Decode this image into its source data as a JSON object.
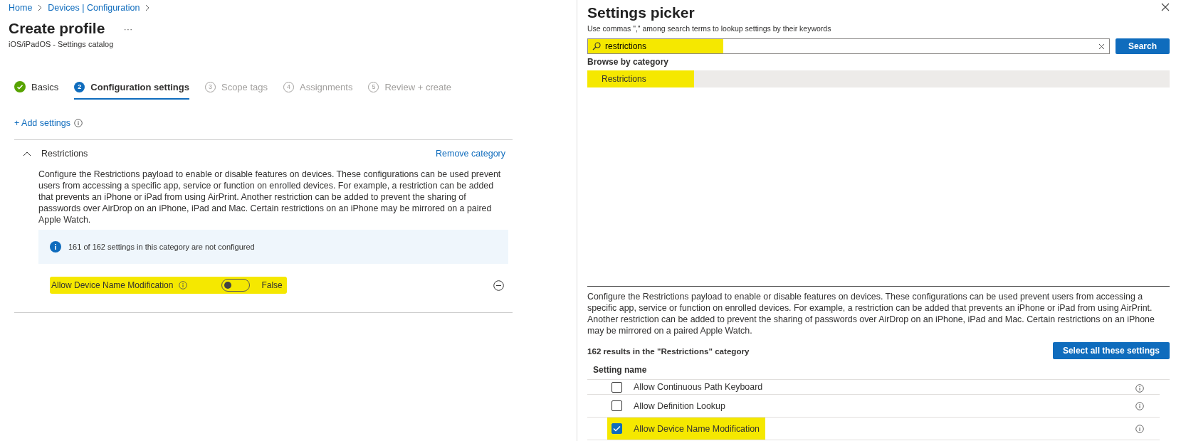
{
  "breadcrumb": [
    "Home",
    "Devices | Configuration"
  ],
  "page": {
    "title": "Create profile",
    "more": "···",
    "subtitle": "iOS/iPadOS - Settings catalog"
  },
  "steps": [
    {
      "label": "Basics",
      "completed": true,
      "selected": false
    },
    {
      "number": "2",
      "label": "Configuration settings",
      "completed": false,
      "selected": true
    },
    {
      "number": "3",
      "label": "Scope tags",
      "completed": false,
      "selected": false
    },
    {
      "number": "4",
      "label": "Assignments",
      "completed": false,
      "selected": false
    },
    {
      "number": "5",
      "label": "Review + create",
      "completed": false,
      "selected": false
    }
  ],
  "add_settings": "+ Add settings",
  "category": {
    "name": "Restrictions",
    "expanded": true,
    "remove": "Remove category",
    "description": "Configure the Restrictions payload to enable or disable features on devices. These configurations can be used prevent users from accessing a specific app, service or function on enrolled devices. For example, a restriction can be added that prevents an iPhone or iPad from using AirPrint. Another restriction can be added to prevent the sharing of passwords over AirDrop on an iPhone, iPad and Mac. Certain restrictions on an iPhone may be mirrored on a paired Apple Watch.",
    "info": "161 of 162 settings in this category are not configured",
    "settings": [
      {
        "name": "Allow Device Name Modification",
        "on": false,
        "value": "False",
        "highlighted": true
      }
    ]
  },
  "picker": {
    "title": "Settings picker",
    "hint": "Use commas \",\" among search terms to lookup settings by their keywords",
    "search": {
      "value": "restrictions",
      "highlighted": true
    },
    "search_button": "Search",
    "browse_label": "Browse by category",
    "categories": [
      {
        "name": "Restrictions",
        "selected": true,
        "highlighted": true
      }
    ],
    "description": "Configure the Restrictions payload to enable or disable features on devices. These configurations can be used prevent users from accessing a specific app, service or function on enrolled devices. For example, a restriction can be added that prevents an iPhone or iPad from using AirPrint. Another restriction can be added to prevent the sharing of passwords over AirDrop on an iPhone, iPad and Mac. Certain restrictions on an iPhone may be mirrored on a paired Apple Watch.",
    "results": "162 results in the \"Restrictions\" category",
    "select_all": "Select all these settings",
    "column": "Setting name",
    "rows": [
      {
        "name": "Allow Continuous Path Keyboard",
        "checked": false,
        "highlighted": false
      },
      {
        "name": "Allow Definition Lookup",
        "checked": false,
        "highlighted": false
      },
      {
        "name": "Allow Device Name Modification",
        "checked": true,
        "highlighted": true
      }
    ]
  }
}
